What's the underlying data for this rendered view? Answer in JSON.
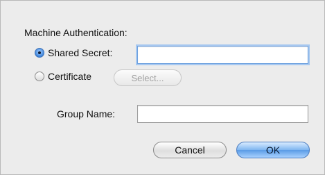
{
  "dialog": {
    "section_title": "Machine Authentication:",
    "shared_secret": {
      "label": "Shared Secret:",
      "selected": true,
      "value": ""
    },
    "certificate": {
      "label": "Certificate",
      "selected": false,
      "select_button_label": "Select..."
    },
    "group_name": {
      "label": "Group Name:",
      "value": ""
    },
    "buttons": {
      "cancel": "Cancel",
      "ok": "OK"
    }
  },
  "colors": {
    "window_background": "#ececec",
    "accent_blue": "#5a9be6"
  }
}
